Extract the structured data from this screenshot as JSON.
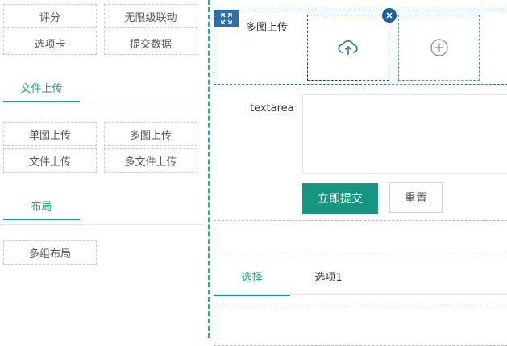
{
  "palette": {
    "top_items": [
      {
        "label": "评分"
      },
      {
        "label": "无限级联动"
      },
      {
        "label": "选项卡"
      },
      {
        "label": "提交数据"
      }
    ],
    "upload_section": {
      "title": "文件上传",
      "items": [
        {
          "label": "单图上传"
        },
        {
          "label": "多图上传"
        },
        {
          "label": "文件上传"
        },
        {
          "label": "多文件上传"
        }
      ]
    },
    "layout_section": {
      "title": "布局",
      "items": [
        {
          "label": "多组布局"
        }
      ]
    }
  },
  "canvas": {
    "multi_image_upload": {
      "label": "多图上传"
    },
    "textarea_field": {
      "label": "textarea",
      "value": ""
    },
    "actions": {
      "submit_label": "立即提交",
      "reset_label": "重置"
    },
    "tabs": [
      {
        "label": "选择",
        "active": true
      },
      {
        "label": "选项1",
        "active": false
      }
    ]
  },
  "colors": {
    "accent": "#16a085",
    "primary_button": "#16967f",
    "selection_blue": "#2f6ea6"
  },
  "icons": {
    "expand": "expand-icon",
    "close": "close-icon",
    "upload": "cloud-upload-icon",
    "add": "plus-circle-icon"
  }
}
